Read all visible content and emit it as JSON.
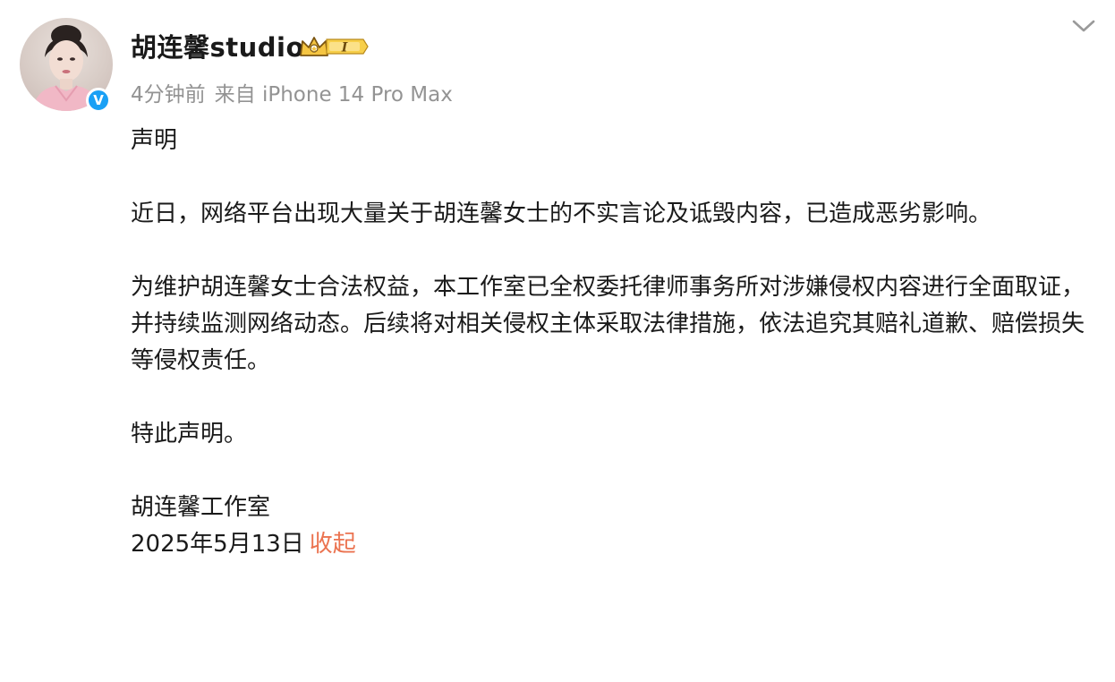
{
  "post": {
    "author": {
      "name": "胡连馨studio",
      "verified": true,
      "vip_level": "I"
    },
    "meta": {
      "time": "4分钟前",
      "source_prefix": "来自",
      "device": "iPhone 14 Pro Max"
    },
    "content": {
      "title": "声明",
      "paragraph1": "近日，网络平台出现大量关于胡连馨女士的不实言论及诋毁内容，已造成恶劣影响。",
      "paragraph2": "为维护胡连馨女士合法权益，本工作室已全权委托律师事务所对涉嫌侵权内容进行全面取证，并持续监测网络动态。后续将对相关侵权主体采取法律措施，依法追究其赔礼道歉、赔偿损失等侵权责任。",
      "closing": "特此声明。",
      "signature": "胡连馨工作室",
      "date": "2025年5月13日",
      "collapse_label": "收起"
    },
    "icons": {
      "menu": "chevron-down-icon",
      "verified": "verified-v-icon",
      "vip": "crown-vip-icon"
    },
    "colors": {
      "link": "#eb7350",
      "meta": "#939393",
      "verified": "#1aa0f5",
      "vip_gold": "#f5c542"
    }
  }
}
